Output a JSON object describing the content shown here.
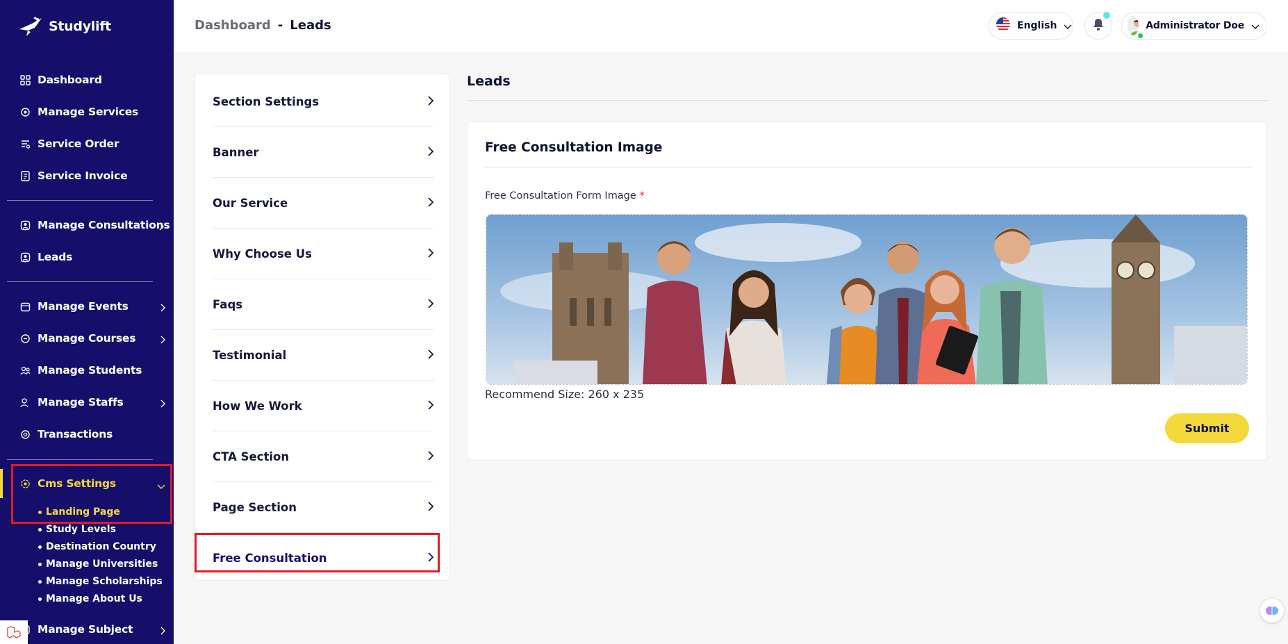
{
  "brand": {
    "name": "Studylift"
  },
  "sidebar": {
    "items": [
      {
        "label": "Dashboard",
        "icon": "dashboard-icon"
      },
      {
        "label": "Manage Services",
        "icon": "services-icon"
      },
      {
        "label": "Service Order",
        "icon": "order-icon"
      },
      {
        "label": "Service Invoice",
        "icon": "invoice-icon"
      },
      {
        "label": "Manage Consultations",
        "icon": "consultation-icon"
      },
      {
        "label": "Leads",
        "icon": "leads-icon"
      },
      {
        "label": "Manage Events",
        "icon": "calendar-icon"
      },
      {
        "label": "Manage Courses",
        "icon": "courses-icon"
      },
      {
        "label": "Manage Students",
        "icon": "students-icon"
      },
      {
        "label": "Manage Staffs",
        "icon": "staffs-icon"
      },
      {
        "label": "Transactions",
        "icon": "transactions-icon"
      },
      {
        "label": "Cms Settings",
        "icon": "cms-icon"
      },
      {
        "label": "Manage Subject",
        "icon": "subject-icon"
      }
    ],
    "cms_sub": [
      {
        "label": "Landing Page"
      },
      {
        "label": "Study Levels"
      },
      {
        "label": "Destination Country"
      },
      {
        "label": "Manage Universities"
      },
      {
        "label": "Manage Scholarships"
      },
      {
        "label": "Manage About Us"
      }
    ]
  },
  "header": {
    "breadcrumb": {
      "parent": "Dashboard",
      "separator": "-",
      "current": "Leads"
    },
    "language": "English",
    "user_name": "Administrator Doe"
  },
  "settings_menu": [
    {
      "label": "Section Settings"
    },
    {
      "label": "Banner"
    },
    {
      "label": "Our Service"
    },
    {
      "label": "Why Choose Us"
    },
    {
      "label": "Faqs"
    },
    {
      "label": "Testimonial"
    },
    {
      "label": "How We Work"
    },
    {
      "label": "CTA Section"
    },
    {
      "label": "Page Section"
    },
    {
      "label": "Free Consultation"
    }
  ],
  "main": {
    "heading": "Leads",
    "card": {
      "title": "Free Consultation Image",
      "field_label": "Free Consultation Form Image",
      "required_mark": "*",
      "hint": "Recommend Size: 260 x 235",
      "submit_label": "Submit"
    }
  },
  "colors": {
    "sidebar_bg": "#150f6b",
    "accent": "#f3da3a",
    "highlight_border": "#e11b22"
  }
}
